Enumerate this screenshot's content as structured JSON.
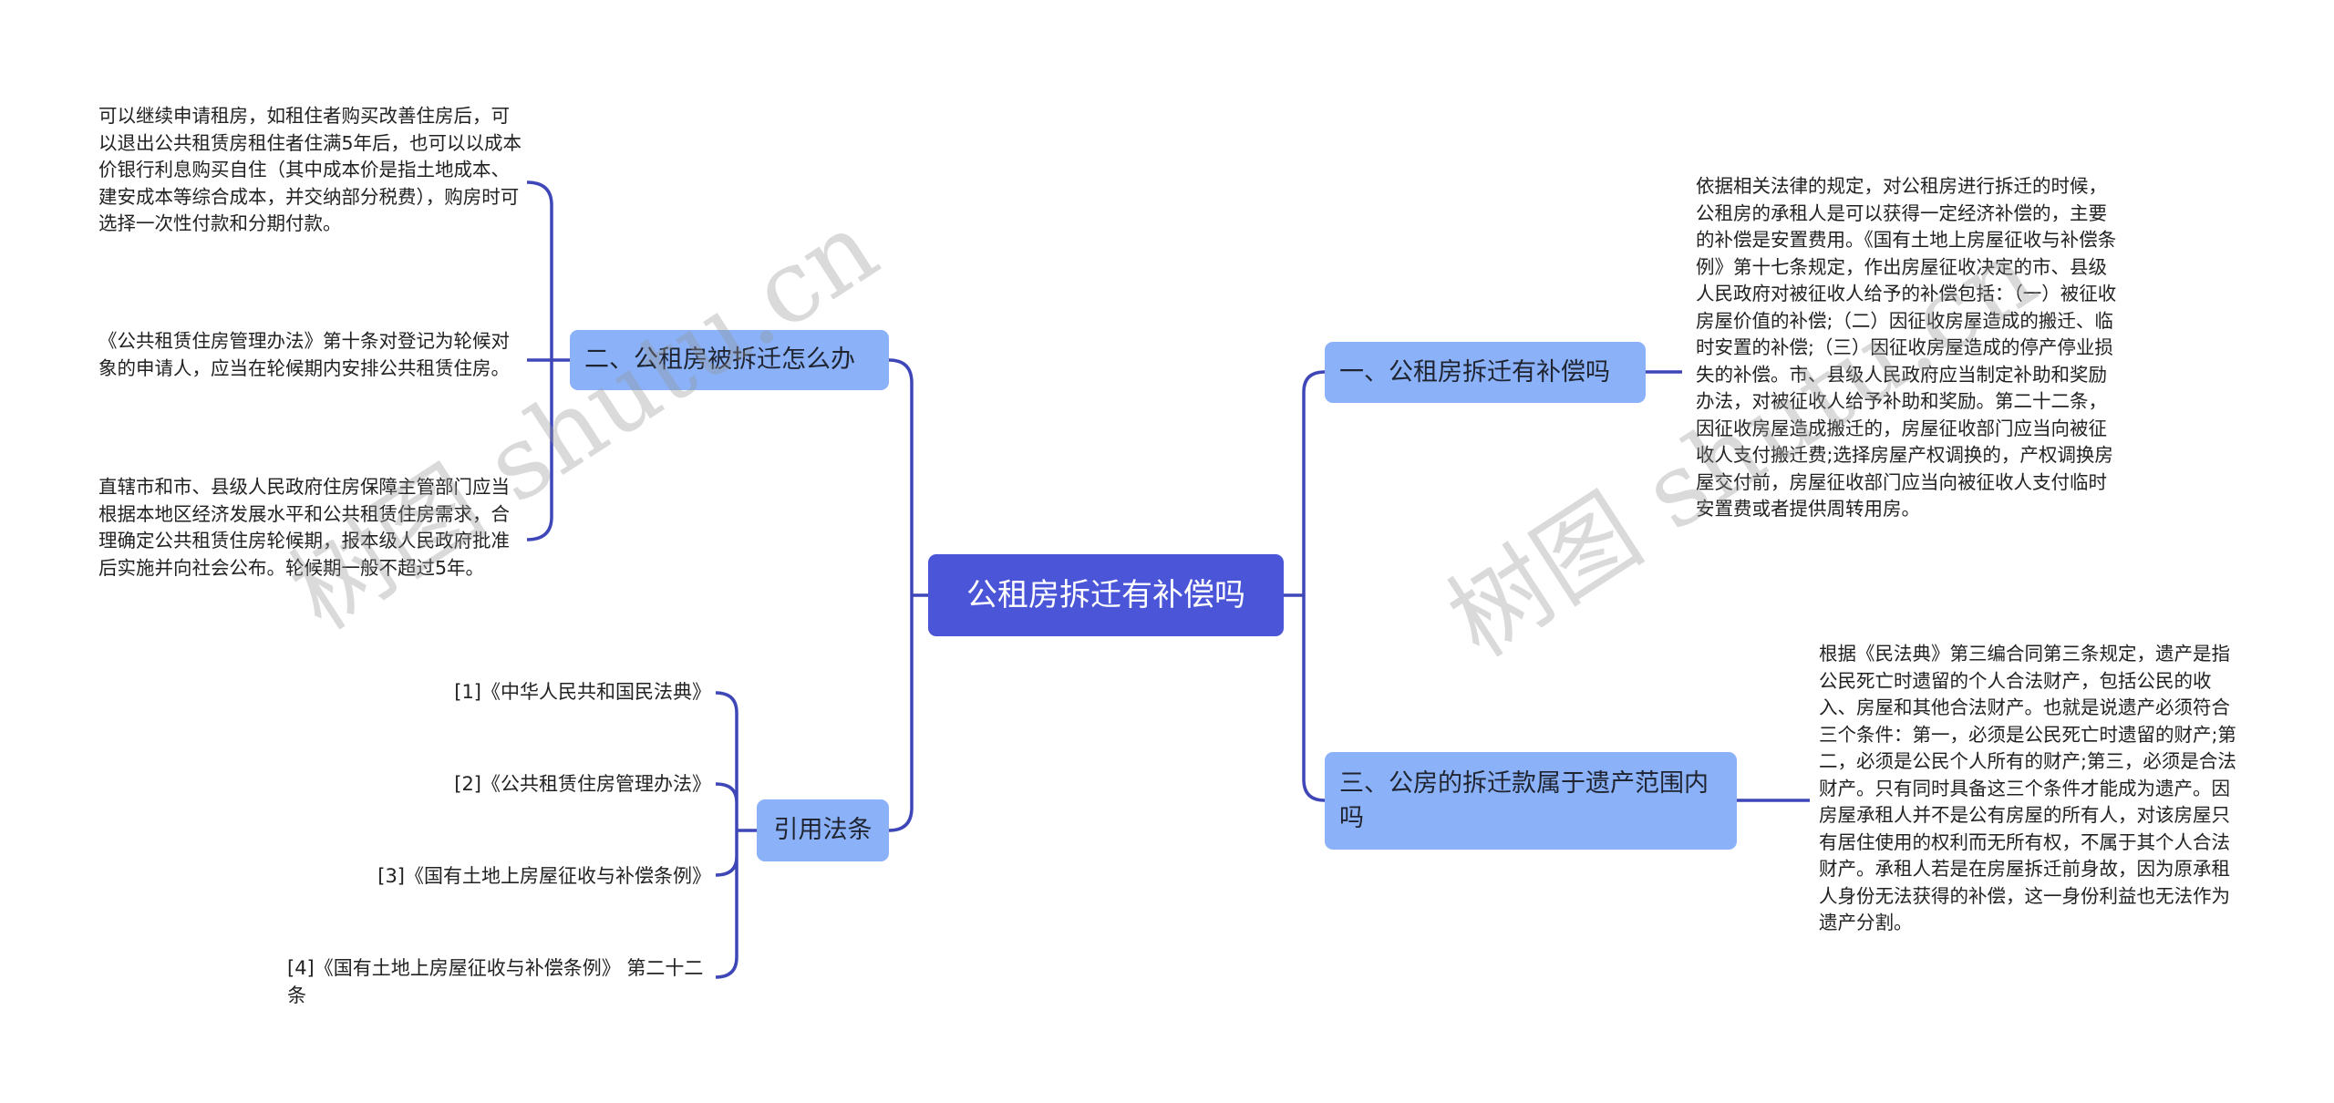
{
  "root": {
    "label": "公租房拆迁有补偿吗"
  },
  "branches": {
    "left_top": {
      "label": "二、公租房被拆迁怎么办",
      "children": [
        "可以继续申请租房，如租住者购买改善住房后，可以退出公共租赁房租住者住满5年后，也可以以成本价银行利息购买自住（其中成本价是指土地成本、建安成本等综合成本，并交纳部分税费），购房时可选择一次性付款和分期付款。",
        "《公共租赁住房管理办法》第十条对登记为轮候对象的申请人，应当在轮候期内安排公共租赁住房。",
        "直辖市和市、县级人民政府住房保障主管部门应当根据本地区经济发展水平和公共租赁住房需求，合理确定公共租赁住房轮候期，报本级人民政府批准后实施并向社会公布。轮候期一般不超过5年。"
      ]
    },
    "left_bottom": {
      "label": "引用法条",
      "children": [
        "[1]《中华人民共和国民法典》",
        "[2]《公共租赁住房管理办法》",
        "[3]《国有土地上房屋征收与补偿条例》",
        "[4]《国有土地上房屋征收与补偿条例》 第二十二条"
      ]
    },
    "right_top": {
      "label": "一、公租房拆迁有补偿吗",
      "children": [
        "依据相关法律的规定，对公租房进行拆迁的时候，公租房的承租人是可以获得一定经济补偿的，主要的补偿是安置费用。《国有土地上房屋征收与补偿条例》第十七条规定，作出房屋征收决定的市、县级人民政府对被征收人给予的补偿包括：（一）被征收房屋价值的补偿;（二）因征收房屋造成的搬迁、临时安置的补偿;（三）因征收房屋造成的停产停业损失的补偿。市、县级人民政府应当制定补助和奖励办法，对被征收人给予补助和奖励。第二十二条，因征收房屋造成搬迁的，房屋征收部门应当向被征收人支付搬迁费;选择房屋产权调换的，产权调换房屋交付前，房屋征收部门应当向被征收人支付临时安置费或者提供周转用房。"
      ]
    },
    "right_bottom": {
      "label": "三、公房的拆迁款属于遗产范围内吗",
      "children": [
        "根据《民法典》第三编合同第三条规定，遗产是指公民死亡时遗留的个人合法财产，包括公民的收入、房屋和其他合法财产。也就是说遗产必须符合三个条件：第一，必须是公民死亡时遗留的财产;第二，必须是公民个人所有的财产;第三，必须是合法财产。只有同时具备这三个条件才能成为遗产。因房屋承租人并不是公有房屋的所有人，对该房屋只有居住使用的权利而无所有权，不属于其个人合法财产。承租人若是在房屋拆迁前身故，因为原承租人身份无法获得的补偿，这一身份利益也无法作为遗产分割。"
      ]
    }
  },
  "watermarks": [
    "树图 shutu.cn",
    "树图 shutu.cn"
  ],
  "colors": {
    "root_fill": "#4A55D8",
    "branch_fill": "#8BB2F9",
    "connector": "#3F47B8"
  }
}
